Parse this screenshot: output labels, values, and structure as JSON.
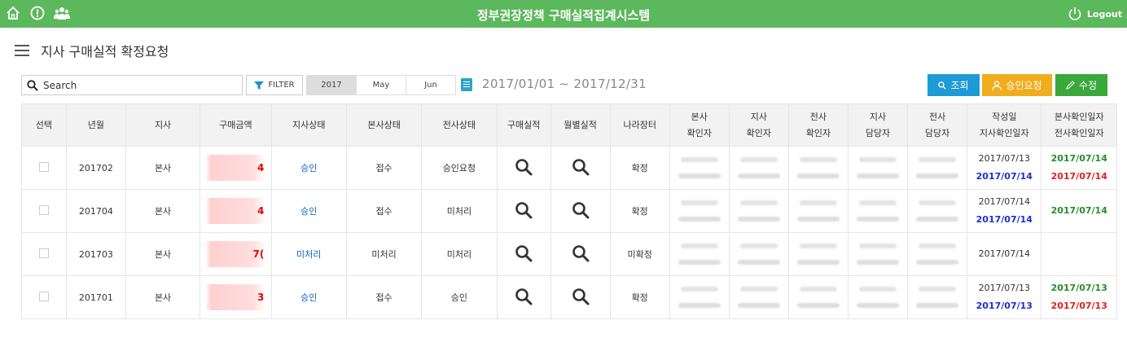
{
  "app": {
    "title": "정부권장정책 구매실적집계시스템",
    "logout_label": "Logout",
    "brand_color": "#5cb85c"
  },
  "page": {
    "title": "지사 구매실적 확정요청"
  },
  "toolbar": {
    "search_placeholder": "Search",
    "filter_label": "FILTER",
    "periods": [
      "2017",
      "May",
      "Jun"
    ],
    "selected_period": "2017",
    "date_range": "2017/01/01 ~ 2017/12/31",
    "search_button": "조회",
    "approve_button": "승인요청",
    "edit_button": "수정"
  },
  "table": {
    "headers": [
      [
        "선택"
      ],
      [
        "년월"
      ],
      [
        "지사"
      ],
      [
        "구매금액"
      ],
      [
        "지사상태"
      ],
      [
        "본사상태"
      ],
      [
        "전사상태"
      ],
      [
        "구매실적"
      ],
      [
        "월별실적"
      ],
      [
        "나라장터"
      ],
      [
        "본사",
        "확인자"
      ],
      [
        "지사",
        "확인자"
      ],
      [
        "전사",
        "확인자"
      ],
      [
        "지사",
        "담당자"
      ],
      [
        "전사",
        "담당자"
      ],
      [
        "작성일",
        "지사확인일자"
      ],
      [
        "본사확인일자",
        "전사확인일자"
      ]
    ],
    "rows": [
      {
        "ym": "201702",
        "branch": "본사",
        "amount_suffix": "4",
        "branch_status": "승인",
        "hq_status": "접수",
        "corp_status": "승인요청",
        "market": "확정",
        "written": "2017/07/13",
        "branch_confirm": "2017/07/14",
        "hq_confirm": "2017/07/14",
        "corp_confirm": "2017/07/14"
      },
      {
        "ym": "201704",
        "branch": "본사",
        "amount_suffix": "4",
        "branch_status": "승인",
        "hq_status": "접수",
        "corp_status": "미처리",
        "market": "확정",
        "written": "2017/07/14",
        "branch_confirm": "2017/07/14",
        "hq_confirm": "2017/07/14",
        "corp_confirm": ""
      },
      {
        "ym": "201703",
        "branch": "본사",
        "amount_suffix": "7(",
        "branch_status": "미처리",
        "hq_status": "미처리",
        "corp_status": "미처리",
        "market": "미확정",
        "written": "2017/07/14",
        "branch_confirm": "",
        "hq_confirm": "",
        "corp_confirm": ""
      },
      {
        "ym": "201701",
        "branch": "본사",
        "amount_suffix": "3",
        "branch_status": "승인",
        "hq_status": "접수",
        "corp_status": "승인",
        "market": "확정",
        "written": "2017/07/13",
        "branch_confirm": "2017/07/13",
        "hq_confirm": "2017/07/13",
        "corp_confirm": "2017/07/13"
      }
    ]
  }
}
